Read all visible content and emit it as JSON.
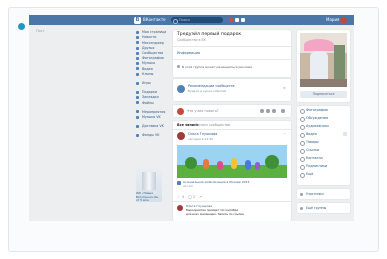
{
  "topbar": {
    "brand": "ВКонтакте",
    "search_placeholder": "Поиск",
    "user_name": "Мария"
  },
  "side_text": "Пост",
  "left_nav": {
    "items": [
      {
        "label": "Моя страница",
        "icon": "home-icon"
      },
      {
        "label": "Новости",
        "icon": "news-icon"
      },
      {
        "label": "Мессенджер",
        "icon": "messages-icon"
      },
      {
        "label": "Друзья",
        "icon": "friends-icon"
      },
      {
        "label": "Сообщества",
        "icon": "groups-icon"
      },
      {
        "label": "Фотографии",
        "icon": "photos-icon"
      },
      {
        "label": "Музыка",
        "icon": "music-icon"
      },
      {
        "label": "Видео",
        "icon": "video-icon"
      },
      {
        "label": "Клипы",
        "icon": "clips-icon"
      }
    ],
    "group2": [
      {
        "label": "Игры",
        "icon": "games-icon"
      }
    ],
    "group3": [
      {
        "label": "Подарки",
        "icon": "gift-icon"
      },
      {
        "label": "Закладки",
        "icon": "bookmark-icon"
      },
      {
        "label": "Файлы",
        "icon": "file-icon"
      }
    ],
    "group4": [
      {
        "label": "Мероприятия",
        "icon": "event-icon"
      },
      {
        "label": "Музыка VK",
        "icon": "vkmusic-icon"
      }
    ],
    "group5": [
      {
        "label": "Доставка VK",
        "icon": "delivery-icon"
      }
    ],
    "group6": [
      {
        "label": "Фонды VK",
        "icon": "fund-icon"
      }
    ],
    "promo_text": "ЖК «Новые Ватутинки» Кв. от 5 млн"
  },
  "profile_card": {
    "title": "Тредуэйл первый подарок",
    "subtitle": "Сообщество в ВК",
    "link_label": "Информация",
    "notice": "В этой группе может размещаться реклама"
  },
  "recommend": {
    "title": "Рекомендации сообществ",
    "subtitle": "Будьте в курсе событий"
  },
  "composer": {
    "placeholder": "Что у вас нового?"
  },
  "tabs": {
    "active": "Все записи",
    "other": "Записи сообщества"
  },
  "post": {
    "author": "Ольга Глушкова",
    "date": "сегодня в 12:30",
    "link_title": "Асоциальная мобилизация в Москве 2023",
    "link_domain": "vk.com",
    "likes": "5",
    "comments": "2",
    "comment_author": "Ольга Глушкова",
    "comment_text": "Мероприятие пройдет 14 сентября",
    "comment_text2": "для всех желающих. Запись по ссылке"
  },
  "right_card": {
    "button": "Подписаться"
  },
  "right_menu": {
    "items": [
      {
        "label": "Фотографии",
        "icon": "photo-icon"
      },
      {
        "label": "Обсуждения",
        "icon": "discuss-icon"
      },
      {
        "label": "Аудиозаписи",
        "icon": "audio-icon"
      },
      {
        "label": "Видео",
        "icon": "video-icon"
      },
      {
        "label": "Товары",
        "icon": "goods-icon"
      },
      {
        "label": "Ссылки",
        "icon": "link-icon"
      },
      {
        "label": "Контакты",
        "icon": "contacts-icon"
      },
      {
        "label": "Подписчики",
        "icon": "followers-icon"
      },
      {
        "label": "Ещё",
        "icon": "more-icon"
      }
    ]
  },
  "right_links": {
    "top_label": "Участники",
    "bottom_label": "Ещё группы"
  }
}
